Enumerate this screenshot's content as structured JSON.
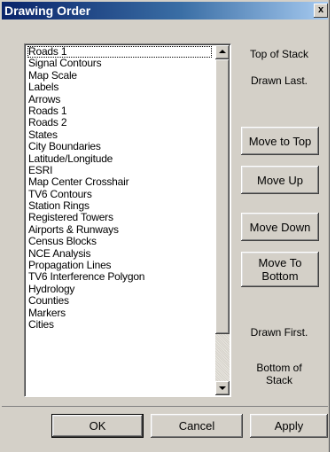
{
  "window": {
    "title": "Drawing Order",
    "close_glyph": "x"
  },
  "list": {
    "items": [
      "Roads 1",
      "Signal Contours",
      "Map Scale",
      "Labels",
      "Arrows",
      "Roads 1",
      "Roads 2",
      "States",
      "City Boundaries",
      "Latitude/Longitude",
      "ESRI",
      "Map Center Crosshair",
      "TV6 Contours",
      "Station Rings",
      "Registered Towers",
      "Airports & Runways",
      "Census Blocks",
      "NCE Analysis",
      "Propagation Lines",
      "TV6 Interference Polygon",
      "Hydrology",
      "Counties",
      "Markers",
      "Cities"
    ],
    "selected_index": 0
  },
  "side": {
    "top_of_stack": "Top of Stack",
    "drawn_last": "Drawn Last.",
    "move_to_top": "Move to Top",
    "move_up": "Move Up",
    "move_down": "Move Down",
    "move_to_bottom": "Move To Bottom",
    "drawn_first": "Drawn First.",
    "bottom_of_stack": "Bottom of Stack"
  },
  "footer": {
    "ok": "OK",
    "cancel": "Cancel",
    "apply": "Apply"
  }
}
